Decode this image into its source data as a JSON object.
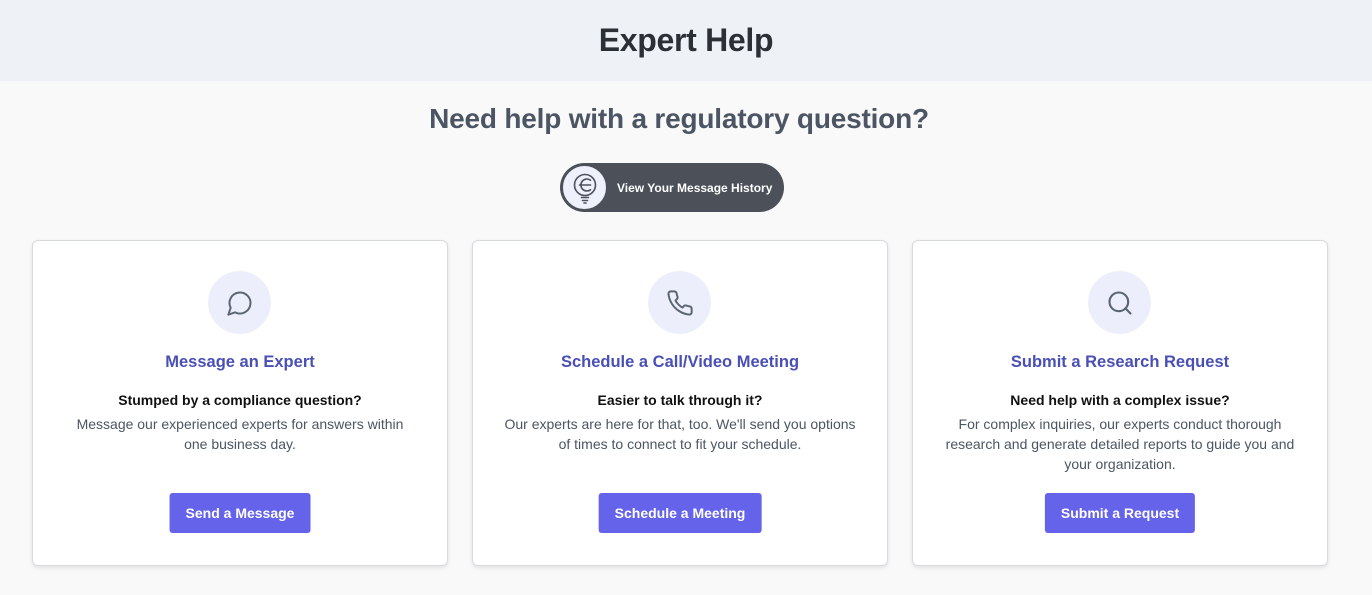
{
  "header": {
    "title": "Expert Help"
  },
  "subtitle": "Need help with a regulatory question?",
  "history_button": {
    "label": "View Your Message History",
    "icon": "lightbulb-icon"
  },
  "cards": [
    {
      "icon": "chat-bubble-icon",
      "title": "Message an Expert",
      "heading": "Stumped by a compliance question?",
      "text": "Message our experienced experts for answers within one business day.",
      "button": "Send a Message"
    },
    {
      "icon": "phone-icon",
      "title": "Schedule a Call/Video Meeting",
      "heading": "Easier to talk through it?",
      "text": "Our experts are here for that, too. We'll send you options of times to connect to fit your schedule.",
      "button": "Schedule a Meeting"
    },
    {
      "icon": "search-icon",
      "title": "Submit a Research Request",
      "heading": "Need help with a complex issue?",
      "text": "For complex inquiries, our experts conduct thorough research and generate detailed reports to guide you and your organization.",
      "button": "Submit a Request"
    }
  ],
  "colors": {
    "accent": "#6563ea",
    "card_title": "#4a4fb5",
    "header_bg": "#eef1f5",
    "history_button_bg": "#4b5059"
  }
}
